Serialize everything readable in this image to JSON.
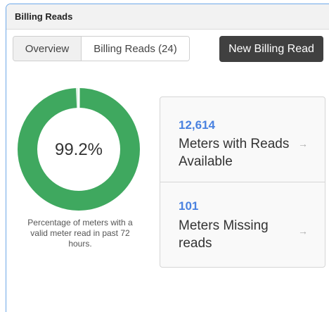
{
  "panel": {
    "title": "Billing Reads"
  },
  "tabs": [
    {
      "label": "Overview",
      "active": true
    },
    {
      "label": "Billing Reads (24)",
      "active": false
    }
  ],
  "new_button_label": "New Billing Read",
  "summary": {
    "percentage_label": "99.2%",
    "percentage_value": 0.992,
    "caption": "Percentage of meters with a valid meter read in past 72 hours.",
    "fill_color": "#3fa85f",
    "track_color": "#d9eee0"
  },
  "stats": [
    {
      "number": "12,614",
      "label": "Meters with Reads Available",
      "arrow": "→"
    },
    {
      "number": "101",
      "label": "Meters Missing reads",
      "arrow": "→"
    }
  ],
  "colors": {
    "accent_blue": "#4a82e0",
    "button_dark": "#404040",
    "panel_border": "#6ea8e8"
  }
}
